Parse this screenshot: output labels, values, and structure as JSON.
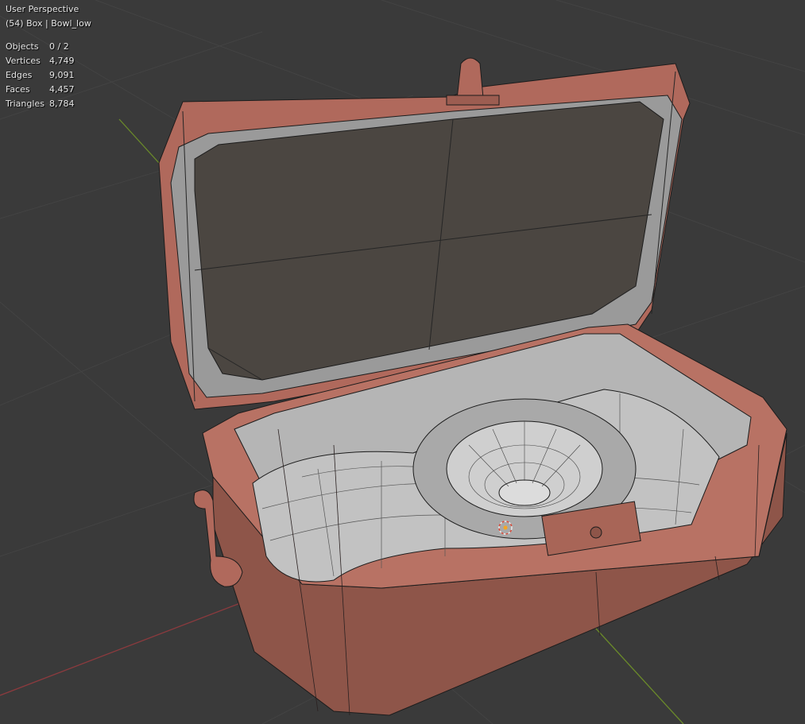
{
  "viewport": {
    "view_name": "User Perspective",
    "object_info": "(54) Box | Bowl_low",
    "stats": [
      {
        "label": "Objects",
        "value": "0 / 2"
      },
      {
        "label": "Vertices",
        "value": "4,749"
      },
      {
        "label": "Edges",
        "value": "9,091"
      },
      {
        "label": "Faces",
        "value": "4,457"
      },
      {
        "label": "Triangles",
        "value": "8,784"
      }
    ]
  },
  "colors": {
    "background": "#3a3a3a",
    "grid_line": "#424242",
    "x_axis": "#8c3a3e",
    "y_axis": "#6a8a2a",
    "box_body": "#b87264",
    "box_shade": "#8a5449",
    "interior": "#bdbdbd",
    "lid_inner": "#4a4540",
    "wire": "#1c1c1c"
  },
  "icons": {
    "origin_marker": "origin-icon",
    "cursor_3d": "3d-cursor-icon"
  }
}
